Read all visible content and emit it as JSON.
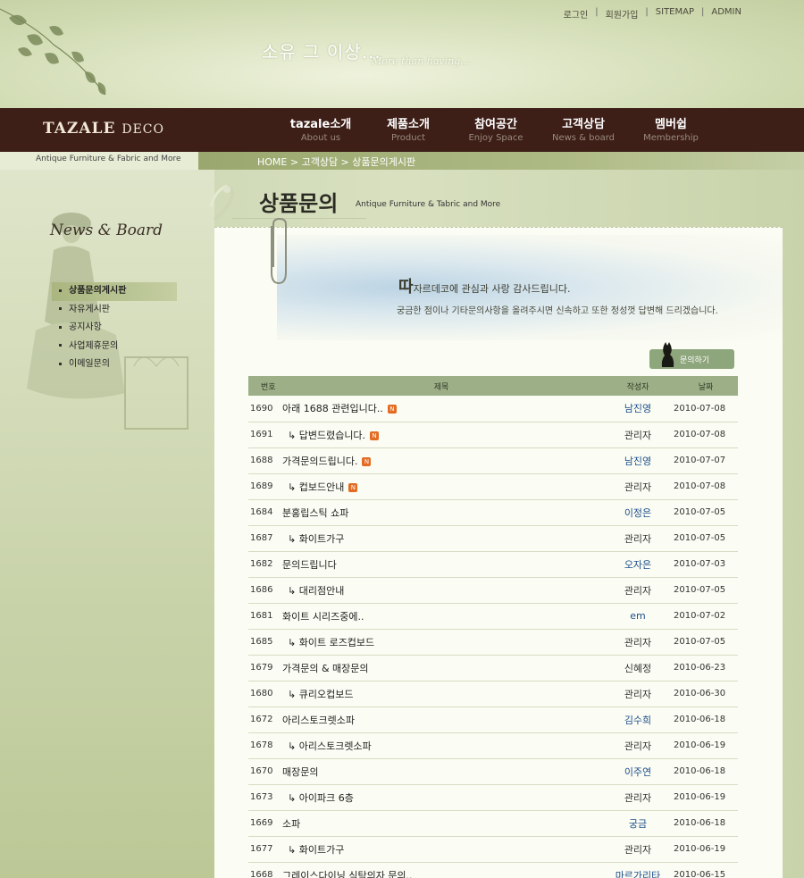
{
  "header": {
    "top_links": [
      "로그인",
      "회원가입",
      "SITEMAP",
      "ADMIN"
    ],
    "slogan": "소유 그 이상...",
    "slogan_sub": "More than having..."
  },
  "nav": {
    "logo_main": "TAZALE",
    "logo_sub": "DECO",
    "items": [
      {
        "ko": "tazale소개",
        "en": "About us"
      },
      {
        "ko": "제품소개",
        "en": "Product"
      },
      {
        "ko": "참여공간",
        "en": "Enjoy Space"
      },
      {
        "ko": "고객상담",
        "en": "News & board"
      },
      {
        "ko": "멤버쉽",
        "en": "Membership"
      }
    ]
  },
  "subbar": {
    "tagline": "Antique Furniture  & Fabric and More",
    "breadcrumb": "HOME > 고객상담 > 상품문의게시판"
  },
  "sidebar": {
    "title": "News & Board",
    "items": [
      "상품문의게시판",
      "자유게시판",
      "공지사항",
      "사업제휴문의",
      "이메일문의"
    ]
  },
  "content": {
    "title": "상품문의",
    "subtitle": "Antique Furniture  & Tabric and More",
    "hero_big": "따",
    "hero_line1": "자르데코에 관심과 사랑 감사드립니다.",
    "hero_line2": "궁금한 점이나 기타문의사항을 올려주시면 신속하고 또한 정성껏 답변해 드리겠습니다.",
    "write_button": "문의하기"
  },
  "board": {
    "headers": [
      "번호",
      "제목",
      "작성자",
      "날짜"
    ],
    "rows": [
      {
        "num": "1690",
        "subject": "아래 1688 관련입니다..",
        "reply": false,
        "new": true,
        "writer": "남진영",
        "member": true,
        "date": "2010-07-08"
      },
      {
        "num": "1691",
        "subject": "↳ 답변드렸습니다.",
        "reply": true,
        "new": true,
        "writer": "관리자",
        "member": false,
        "date": "2010-07-08"
      },
      {
        "num": "1688",
        "subject": "가격문의드립니다.",
        "reply": false,
        "new": true,
        "writer": "남진영",
        "member": true,
        "date": "2010-07-07"
      },
      {
        "num": "1689",
        "subject": "↳ 컵보드안내",
        "reply": true,
        "new": true,
        "writer": "관리자",
        "member": false,
        "date": "2010-07-08"
      },
      {
        "num": "1684",
        "subject": "분홍립스틱 쇼파",
        "reply": false,
        "new": false,
        "writer": "이정은",
        "member": true,
        "date": "2010-07-05"
      },
      {
        "num": "1687",
        "subject": "↳ 화이트가구",
        "reply": true,
        "new": false,
        "writer": "관리자",
        "member": false,
        "date": "2010-07-05"
      },
      {
        "num": "1682",
        "subject": "문의드립니다",
        "reply": false,
        "new": false,
        "writer": "오자은",
        "member": true,
        "date": "2010-07-03"
      },
      {
        "num": "1686",
        "subject": "↳ 대리점안내",
        "reply": true,
        "new": false,
        "writer": "관리자",
        "member": false,
        "date": "2010-07-05"
      },
      {
        "num": "1681",
        "subject": "화이트 시리즈중에..",
        "reply": false,
        "new": false,
        "writer": "em",
        "member": true,
        "date": "2010-07-02"
      },
      {
        "num": "1685",
        "subject": "↳ 화이트 로즈컵보드",
        "reply": true,
        "new": false,
        "writer": "관리자",
        "member": false,
        "date": "2010-07-05"
      },
      {
        "num": "1679",
        "subject": "가격문의 & 매장문의",
        "reply": false,
        "new": false,
        "writer": "신혜정",
        "member": false,
        "date": "2010-06-23"
      },
      {
        "num": "1680",
        "subject": "↳ 큐리오컵보드",
        "reply": true,
        "new": false,
        "writer": "관리자",
        "member": false,
        "date": "2010-06-30"
      },
      {
        "num": "1672",
        "subject": "아리스토크렛소파",
        "reply": false,
        "new": false,
        "writer": "김수희",
        "member": true,
        "date": "2010-06-18"
      },
      {
        "num": "1678",
        "subject": "↳ 아리스토크렛소파",
        "reply": true,
        "new": false,
        "writer": "관리자",
        "member": false,
        "date": "2010-06-19"
      },
      {
        "num": "1670",
        "subject": "매장문의",
        "reply": false,
        "new": false,
        "writer": "이주연",
        "member": true,
        "date": "2010-06-18"
      },
      {
        "num": "1673",
        "subject": "↳ 아이파크 6층",
        "reply": true,
        "new": false,
        "writer": "관리자",
        "member": false,
        "date": "2010-06-19"
      },
      {
        "num": "1669",
        "subject": "소파",
        "reply": false,
        "new": false,
        "writer": "궁금",
        "member": true,
        "date": "2010-06-18"
      },
      {
        "num": "1677",
        "subject": "↳ 화이트가구",
        "reply": true,
        "new": false,
        "writer": "관리자",
        "member": false,
        "date": "2010-06-19"
      },
      {
        "num": "1668",
        "subject": "그레이스다이닝 식탁의자 문의..",
        "reply": false,
        "new": false,
        "writer": "마르가리타",
        "member": true,
        "date": "2010-06-15"
      }
    ]
  },
  "colors": {
    "navbar": "#3d1f18",
    "table_header": "#9caf87",
    "member_name": "#1c4f8c",
    "new_badge": "#e36b22"
  },
  "icons": {
    "new_badge": "N",
    "write_icon": "cat-icon"
  }
}
